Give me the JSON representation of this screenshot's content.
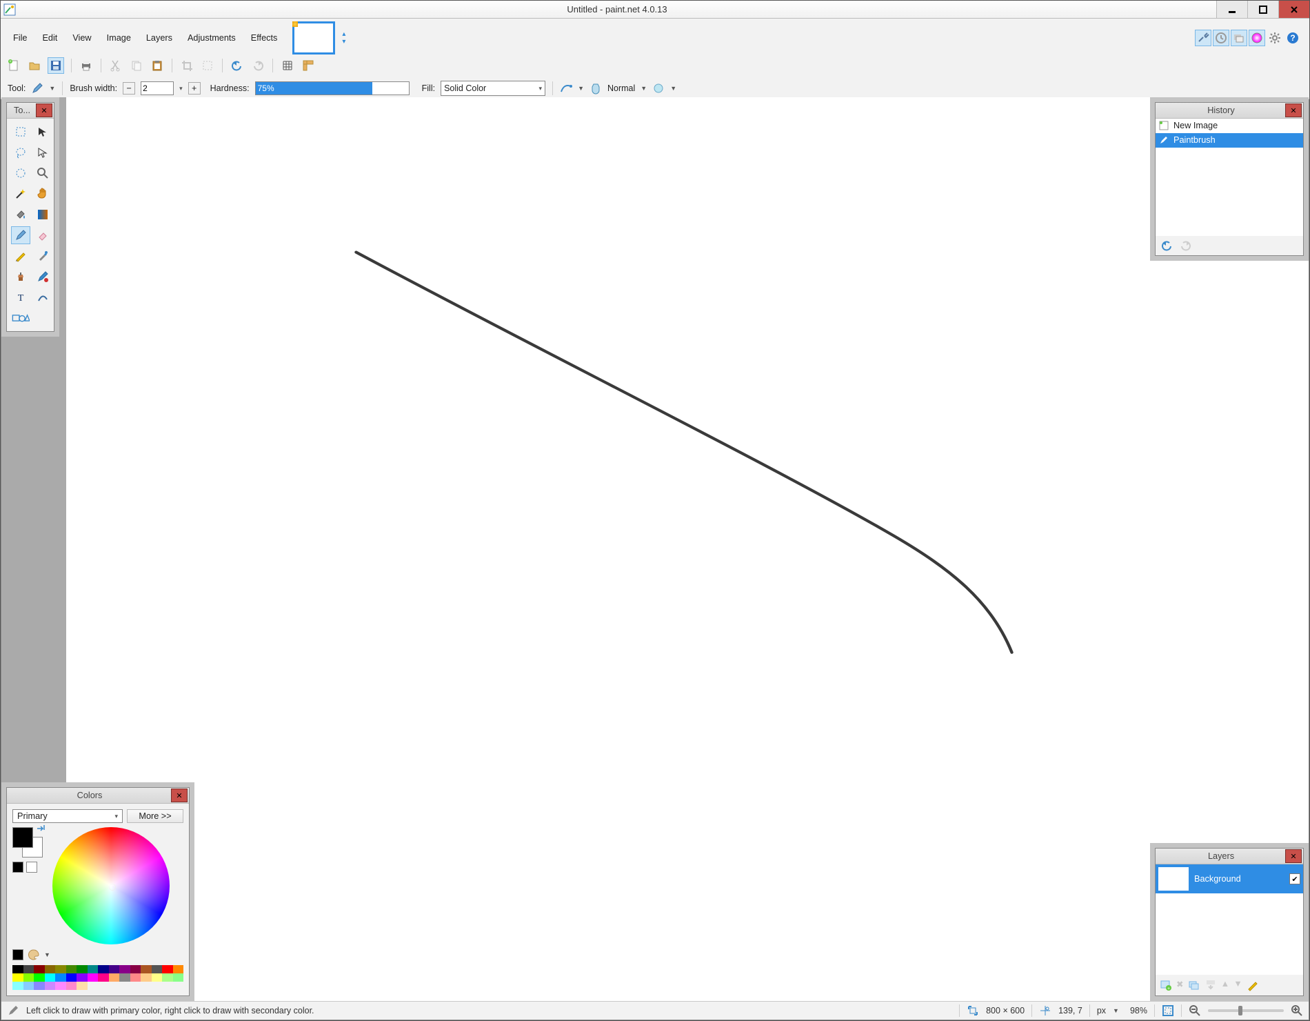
{
  "window": {
    "title": "Untitled - paint.net 4.0.13"
  },
  "menu": {
    "items": [
      "File",
      "Edit",
      "View",
      "Image",
      "Layers",
      "Adjustments",
      "Effects"
    ]
  },
  "options": {
    "tool_label": "Tool:",
    "brush_label": "Brush width:",
    "brush_width": "2",
    "hardness_label": "Hardness:",
    "hardness_value": "75%",
    "hardness_pct": 75,
    "fill_label": "Fill:",
    "fill_value": "Solid Color",
    "blend_value": "Normal"
  },
  "panels": {
    "tools_title": "To...",
    "history_title": "History",
    "layers_title": "Layers",
    "colors_title": "Colors"
  },
  "history": {
    "items": [
      {
        "label": "New Image",
        "selected": false
      },
      {
        "label": "Paintbrush",
        "selected": true
      }
    ]
  },
  "layers": {
    "items": [
      {
        "label": "Background",
        "checked": true
      }
    ]
  },
  "colors": {
    "selector": "Primary",
    "more": "More >>",
    "palette": [
      "#000",
      "#444",
      "#800",
      "#860",
      "#880",
      "#480",
      "#080",
      "#088",
      "#008",
      "#408",
      "#808",
      "#804",
      "#a52",
      "#555",
      "#f00",
      "#f80",
      "#ff0",
      "#8f0",
      "#0f0",
      "#0ff",
      "#08f",
      "#00f",
      "#80f",
      "#f0f",
      "#f08",
      "#fa6",
      "#888",
      "#f88",
      "#fc8",
      "#ff8",
      "#af8",
      "#8f8",
      "#8ff",
      "#8cf",
      "#88f",
      "#c8f",
      "#f8f",
      "#f8c",
      "#fda"
    ]
  },
  "status": {
    "hint": "Left click to draw with primary color, right click to draw with secondary color.",
    "size": "800 × 600",
    "pos": "139, 7",
    "unit": "px",
    "zoom": "98%"
  }
}
